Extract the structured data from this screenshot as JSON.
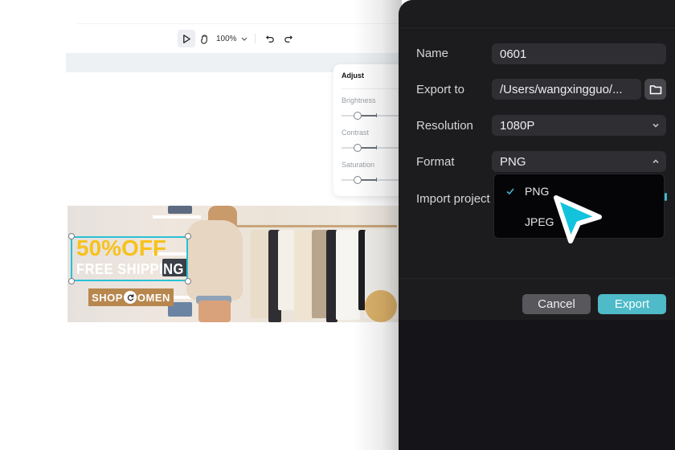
{
  "toolbar": {
    "select_tool": "select-tool",
    "hand_tool": "hand-tool",
    "zoom_level": "100%",
    "undo": "undo",
    "redo": "redo"
  },
  "adjust_panel": {
    "title": "Adjust",
    "sliders": [
      {
        "label": "Brightness",
        "value": 0.3
      },
      {
        "label": "Contrast",
        "value": 0.3
      },
      {
        "label": "Saturation",
        "value": 0.3
      }
    ]
  },
  "banner": {
    "headline": "50%OFF",
    "subheadline": "FREE SHIPPING",
    "cta_left": "SHOP",
    "cta_right": "OMEN",
    "colors": {
      "headline": "#f6c21c",
      "cta_bg": "#b8874e",
      "selection": "#29c1d6"
    }
  },
  "export_dialog": {
    "fields": {
      "name": {
        "label": "Name",
        "value": "0601"
      },
      "export_to": {
        "label": "Export to",
        "value": "/Users/wangxingguo/..."
      },
      "resolution": {
        "label": "Resolution",
        "value": "1080P"
      },
      "format": {
        "label": "Format",
        "value": "PNG"
      },
      "import_project": {
        "label": "Import project"
      }
    },
    "format_options": [
      {
        "label": "PNG",
        "selected": true
      },
      {
        "label": "JPEG",
        "selected": false
      }
    ],
    "buttons": {
      "cancel": "Cancel",
      "export": "Export"
    },
    "colors": {
      "accent": "#4fbac8",
      "background": "#1c1c1e",
      "field": "#2e2e33"
    }
  }
}
